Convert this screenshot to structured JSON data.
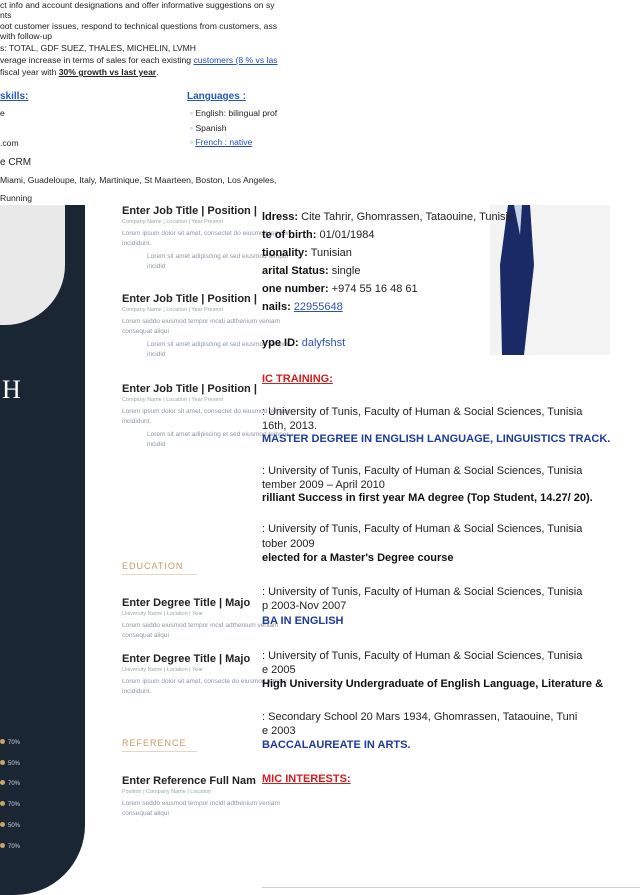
{
  "top": {
    "lines": [
      "ct info and account designations and offer informative suggestions on sy",
      "nts",
      "oot customer issues, respond to technical questions from customers, ass",
      "with follow-up",
      "s: TOTAL, GDF SUEZ, THALES, MICHELIN, LVMH",
      "verage increase in terms of sales for each existing"
    ],
    "line6_link": "customers",
    "line6_tail": " (8 % vs las",
    "line7_pre": " fiscal year with ",
    "line7_bold": "30% growth vs last year",
    "line7_post": ".",
    "skills_heading": "skills:",
    "skills": [
      "e",
      "",
      ".com",
      "e CRM"
    ],
    "languages_heading": "Languages :",
    "languages": [
      "English: bilingual prof",
      "Spanish",
      "French : native"
    ],
    "places": "Miami, Guadeloupe, Italy, Martinique, St Maarteen, Boston, Los Angeles,",
    "hobby": "Running"
  },
  "template": {
    "initial": "H",
    "skills_pct": [
      "70%",
      "50%",
      "70%",
      "70%",
      "50%",
      "70%"
    ],
    "entries": [
      {
        "title": "Enter Job Title | Position |",
        "sub": "Company Name | Location | Year Present",
        "text": "Lorem ipsum dolor sit amet, consectet do eiusmod tempor incididunt.",
        "bullet": "Lorem sit amet adipiscing et sed eiusmod tempor incidid"
      },
      {
        "title": "Enter Job Title | Position |",
        "sub": "Company Name | Location | Year Present",
        "text": "Lorem seddo eiusmod tempor incidi adthenium veniam consequat aliqui",
        "bullet": "Lorem sit amet adipiscing et sed eiusmod tempor incidid"
      },
      {
        "title": "Enter Job Title | Position |",
        "sub": "Company Name | Location | Year Present",
        "text": "Lorem ipsum dolor sit amet, consectet do eiusmod tempor incididunt.",
        "bullet": "Lorem sit amet adipiscing et sed eiusmod tempor incidid"
      }
    ],
    "education_heading": "EDUCATION",
    "education": [
      {
        "title": "Enter Degree Title | Majo",
        "sub": "University Name | Location | Year",
        "text": "Lorem seddo eiusmod tempor incid adthenium veniam consequat aliqui"
      },
      {
        "title": "Enter Degree Title | Majo",
        "sub": "University Name | Location | Year",
        "text": "Lorem ipsum dolor sit amet, consecte do eiusmod tempor incididunt."
      }
    ],
    "reference_heading": "REFERENCE",
    "reference": {
      "title": "Enter Reference Full Nam",
      "sub": "Position | Company Name | Location",
      "text": "Lorem seddo eiusmod tempor incidi adthenium veniam consequat aliqui"
    }
  },
  "cv": {
    "address_label": "ldress:",
    "address": " Cite Tahrir, Ghomrassen, Tataouine, Tunisie",
    "birth_label": "te of birth:",
    "birth": " 01/01/1984",
    "nationality_label": "tionality:",
    "nationality": " Tunisian",
    "marital_label": "arital Status:",
    "marital": " single",
    "phone_label": "one number:",
    "phone": " +974 55 16 48 61",
    "emails_label": "nails:",
    "emails": "22955648",
    "skype_label": "ype ID:",
    "skype": " dalyfshst",
    "training_heading": "IC TRAINING:",
    "items": [
      {
        "line1": ": University of Tunis, Faculty of Human & Social Sciences, Tunisia",
        "line2": "16th, 2013.",
        "line3": "MASTER DEGREE IN ENGLISH LANGUAGE, LINGUISTICS TRACK.",
        "style": "navy"
      },
      {
        "line1": ": University of Tunis, Faculty of Human & Social Sciences, Tunisia",
        "line2": "tember 2009 – April 2010",
        "line3": "rilliant Success in first year MA degree (Top Student, 14.27/ 20).",
        "style": "blk"
      },
      {
        "line1": ": University of Tunis, Faculty of Human & Social Sciences, Tunisia",
        "line2": "tober 2009",
        "line3": "elected for a Master's Degree course",
        "style": "blk"
      },
      {
        "line1": ": University of Tunis, Faculty of Human & Social Sciences, Tunisia",
        "line2": "p 2003-Nov 2007",
        "line3": "BA IN ENGLISH",
        "style": "navy"
      },
      {
        "line1": ": University of Tunis, Faculty of Human & Social Sciences, Tunisia",
        "line2": "e 2005",
        "line3": "High University Undergraduate of English Language, Literature &",
        "style": "blk"
      },
      {
        "line1": ": Secondary School 20 Mars 1934, Ghomrassen, Tataouine, Tuni",
        "line2": "e 2003",
        "line3": "BACCALAUREATE IN ARTS.",
        "style": "navy"
      }
    ],
    "interests_heading": "MIC INTERESTS:"
  }
}
